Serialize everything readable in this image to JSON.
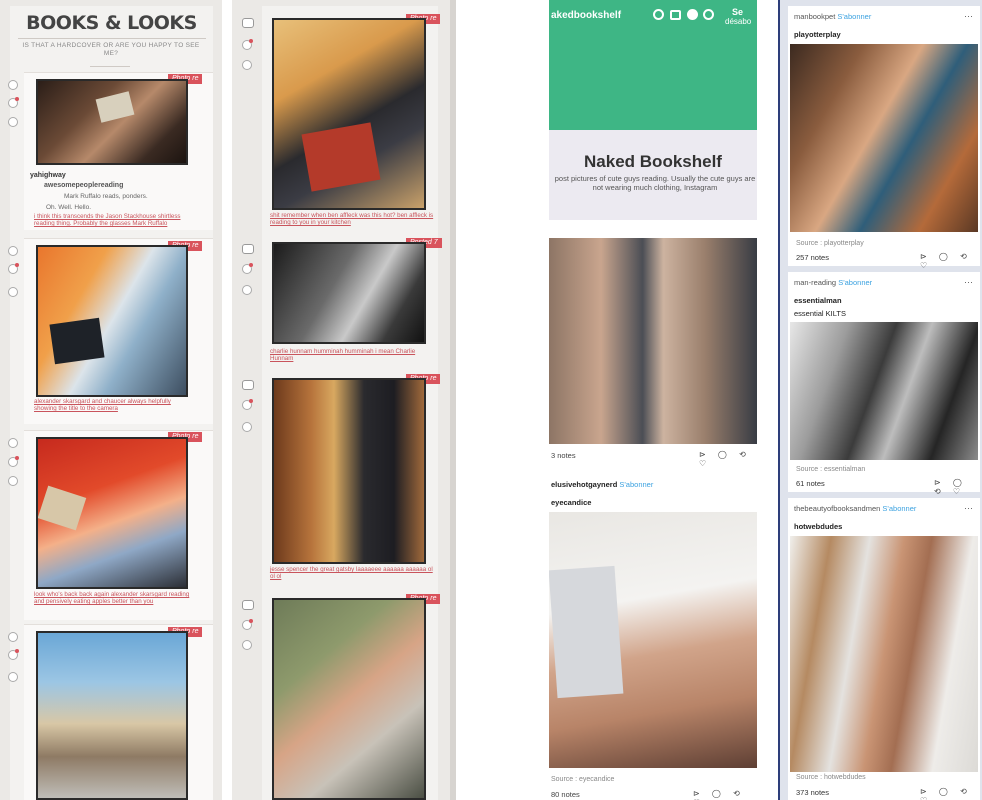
{
  "panel1": {
    "title": "BOOKS & LOOKS",
    "subtitle": "IS THAT A HARDCOVER OR ARE YOU HAPPY TO SEE ME?",
    "posts": [
      {
        "tag": "Photo re",
        "reblogger": "yahighway",
        "source_user": "awesomepeoplereading",
        "quote1": "Mark Ruffalo reads, ponders.",
        "quote2": "Oh. Well. Hello.",
        "caption": "i think this transcends the Jason Stackhouse shirtless reading thing. Probably the glasses Mark Ruffalo"
      },
      {
        "tag": "Photo re",
        "caption": "alexander skarsgard and chaucer always helpfully showing the title to the camera"
      },
      {
        "tag": "Photo re",
        "caption": "look who's back back again alexander skarsgard reading and pensively eating apples better than you"
      },
      {
        "tag": "Photo re"
      }
    ]
  },
  "panel2": {
    "posts": [
      {
        "tag": "Photo re",
        "caption": "shit remember when ben affleck was this hot? ben affleck is reading to you in your kitchen"
      },
      {
        "tag": "Posted 7",
        "caption": "charlie hunnam humminah humminah i mean Charlie Hunnam"
      },
      {
        "tag": "Photo re",
        "caption": "jesse spencer the great gatsby laaaaeee aaaaaa aaaaaa ol ol ol"
      },
      {
        "tag": "Photo re"
      }
    ]
  },
  "panel3": {
    "topbar_title": "akedbookshelf",
    "topbar_right1": "Se",
    "topbar_right2": "désabo",
    "blog_name": "Naked Bookshelf",
    "description": "post pictures of cute guys reading.  Usually the cute guys are not wearing much clothing, Instagram",
    "post1_notes": "3 notes",
    "post2_user": "elusivehotgaynerd",
    "post2_follow": "S'abonner",
    "post2_source_blog": "eyecandice",
    "post2_source": "Source : eyecandice",
    "post2_notes": "80 notes"
  },
  "panel4": {
    "posts": [
      {
        "user": "manbookpet",
        "follow": "S'abonner",
        "reblog_from": "playotterplay",
        "body": "",
        "source": "Source : playotterplay",
        "notes": "257 notes"
      },
      {
        "user": "man-reading",
        "follow": "S'abonner",
        "reblog_from": "essentialman",
        "body": "essential KILTS",
        "source": "Source : essentialman",
        "notes": "61 notes"
      },
      {
        "user": "thebeautyofbooksandmen",
        "follow": "S'abonner",
        "reblog_from": "hotwebdudes",
        "body": "",
        "source": "Source : hotwebdudes",
        "notes": "373 notes"
      }
    ]
  },
  "ui": {
    "more_dots": "···",
    "actions": "⊳ ◯ ⟲ ♡"
  }
}
